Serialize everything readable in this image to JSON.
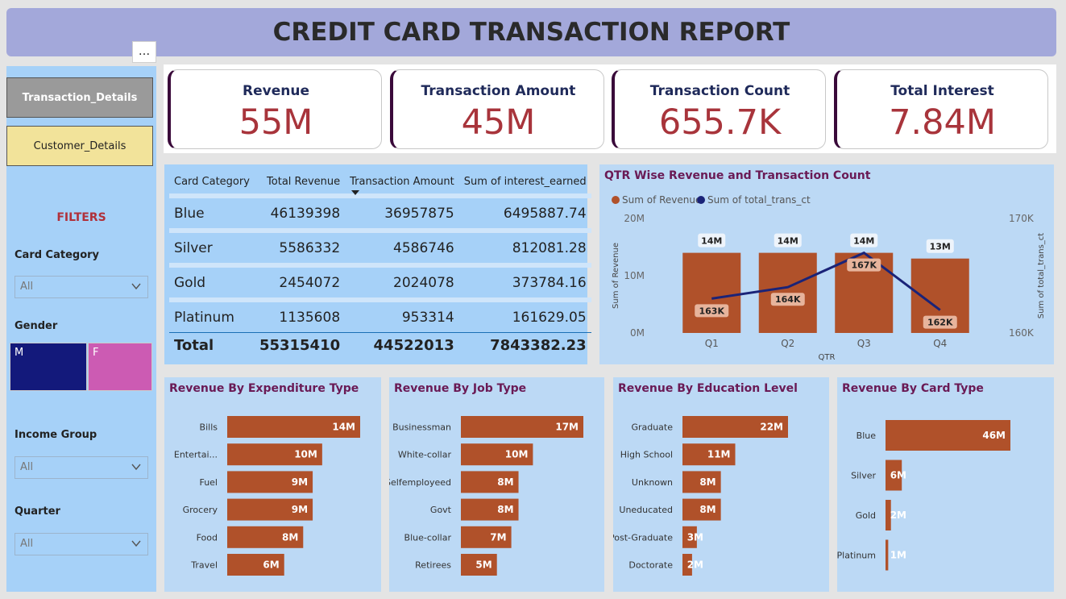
{
  "header": {
    "title": "CREDIT CARD TRANSACTION REPORT"
  },
  "more_options": "...",
  "sidebar": {
    "buttons": {
      "transaction_details": "Transaction_Details",
      "customer_details": "Customer_Details"
    },
    "filters_title": "FILTERS",
    "card_category": {
      "label": "Card Category",
      "value": "All"
    },
    "gender": {
      "label": "Gender",
      "options": [
        "M",
        "F"
      ]
    },
    "income_group": {
      "label": "Income Group",
      "value": "All"
    },
    "quarter": {
      "label": "Quarter",
      "value": "All"
    }
  },
  "kpis": [
    {
      "label": "Revenue",
      "value": "55M"
    },
    {
      "label": "Transaction Amount",
      "value": "45M"
    },
    {
      "label": "Transaction Count",
      "value": "655.7K"
    },
    {
      "label": "Total Interest",
      "value": "7.84M"
    }
  ],
  "colors": {
    "bar": "#b0512a",
    "line": "#1a2378",
    "kpi_value": "#a8343b",
    "title": "#6a1a55",
    "gender_m": "#13197b",
    "gender_f": "#cc5bb3"
  },
  "table": {
    "headers": [
      "Card Category",
      "Total Revenue",
      "Transaction Amount",
      "Sum of interest_earned"
    ],
    "rows": [
      [
        "Blue",
        "46139398",
        "36957875",
        "6495887.74"
      ],
      [
        "Silver",
        "5586332",
        "4586746",
        "812081.28"
      ],
      [
        "Gold",
        "2454072",
        "2024078",
        "373784.16"
      ],
      [
        "Platinum",
        "1135608",
        "953314",
        "161629.05"
      ]
    ],
    "total": [
      "Total",
      "55315410",
      "44522013",
      "7843382.23"
    ]
  },
  "chart_data": [
    {
      "type": "bar",
      "title": "QTR Wise Revenue and Transaction Count",
      "legend": [
        "Sum of Revenue",
        "Sum of total_trans_ct"
      ],
      "legend_placement": "top-left",
      "categories": [
        "Q1",
        "Q2",
        "Q3",
        "Q4"
      ],
      "xlabel": "QTR",
      "ylabel": "Sum of Revenue",
      "y2label": "Sum of total_trans_ct",
      "y_ticks": [
        "0M",
        "10M",
        "20M"
      ],
      "y2_ticks": [
        "160K",
        "170K"
      ],
      "ylim": [
        0,
        20
      ],
      "y2lim": [
        160,
        170
      ],
      "series": [
        {
          "name": "Sum of Revenue",
          "type": "bar",
          "values": [
            14,
            14,
            14,
            13
          ],
          "labels": [
            "14M",
            "14M",
            "14M",
            "13M"
          ]
        },
        {
          "name": "Sum of total_trans_ct",
          "type": "line",
          "values": [
            163,
            164,
            167,
            162
          ],
          "labels": [
            "163K",
            "164K",
            "167K",
            "162K"
          ]
        }
      ]
    },
    {
      "type": "bar",
      "title": "Revenue By Expenditure Type",
      "categories": [
        "Bills",
        "Entertai...",
        "Fuel",
        "Grocery",
        "Food",
        "Travel"
      ],
      "values": [
        14,
        10,
        9,
        9,
        8,
        6
      ],
      "labels": [
        "14M",
        "10M",
        "9M",
        "9M",
        "8M",
        "6M"
      ]
    },
    {
      "type": "bar",
      "title": "Revenue By Job Type",
      "categories": [
        "Businessman",
        "White-collar",
        "Selfemployeed",
        "Govt",
        "Blue-collar",
        "Retirees"
      ],
      "values": [
        17,
        10,
        8,
        8,
        7,
        5
      ],
      "labels": [
        "17M",
        "10M",
        "8M",
        "8M",
        "7M",
        "5M"
      ]
    },
    {
      "type": "bar",
      "title": "Revenue By Education Level",
      "categories": [
        "Graduate",
        "High School",
        "Unknown",
        "Uneducated",
        "Post-Graduate",
        "Doctorate"
      ],
      "values": [
        22,
        11,
        8,
        8,
        3,
        2
      ],
      "labels": [
        "22M",
        "11M",
        "8M",
        "8M",
        "3M",
        "2M"
      ]
    },
    {
      "type": "bar",
      "title": "Revenue By Card Type",
      "categories": [
        "Blue",
        "Silver",
        "Gold",
        "Platinum"
      ],
      "values": [
        46,
        6,
        2,
        1
      ],
      "labels": [
        "46M",
        "6M",
        "2M",
        "1M"
      ]
    }
  ]
}
